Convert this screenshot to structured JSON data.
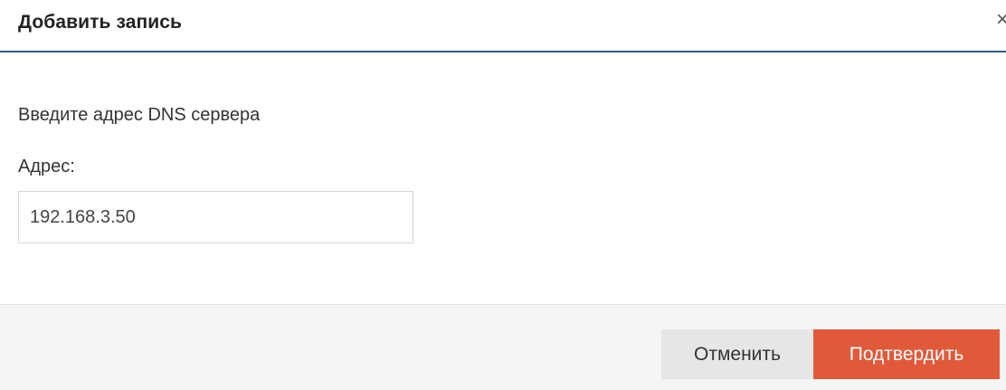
{
  "dialog": {
    "title": "Добавить запись",
    "close_symbol": "×",
    "close_icon": "close-icon"
  },
  "body": {
    "instruction": "Введите адрес DNS сервера",
    "address_label": "Адрес:",
    "address_value": "192.168.3.50"
  },
  "footer": {
    "cancel_label": "Отменить",
    "confirm_label": "Подтвердить"
  },
  "colors": {
    "header_divider": "#2f5e8e",
    "confirm_button": "#e05a3a",
    "cancel_button": "#e6e6e6",
    "footer_background": "#f5f5f5"
  }
}
